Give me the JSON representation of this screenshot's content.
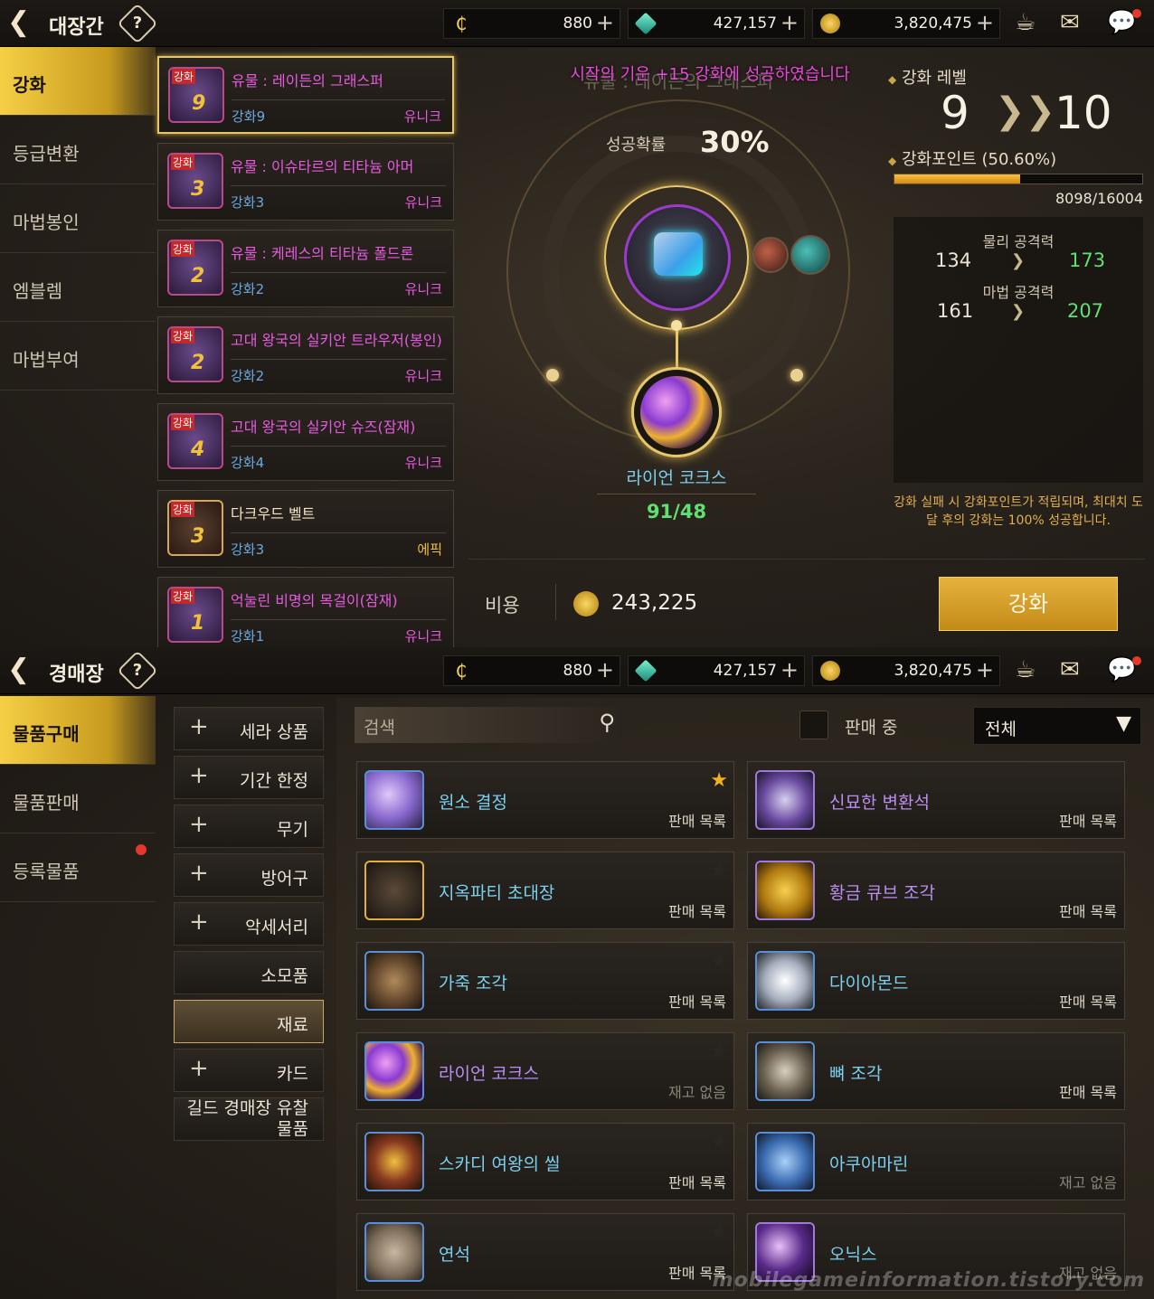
{
  "top_panel": {
    "title": "대장간",
    "help": "?",
    "currency": {
      "cera": "880",
      "gem": "427,157",
      "gold": "3,820,475",
      "plus": "+"
    },
    "sidebar": [
      "강화",
      "등급변환",
      "마법봉인",
      "엠블렘",
      "마법부여"
    ],
    "items": [
      {
        "pre": "강화",
        "lv": "9",
        "name": "유물 : 레이든의 그래스퍼",
        "stage": "강화9",
        "grade": "유니크"
      },
      {
        "pre": "강화",
        "lv": "3",
        "name": "유물 : 이슈타르의 티타늄 아머",
        "stage": "강화3",
        "grade": "유니크"
      },
      {
        "pre": "강화",
        "lv": "2",
        "name": "유물 : 케레스의 티타늄 폴드론",
        "stage": "강화2",
        "grade": "유니크"
      },
      {
        "pre": "강화",
        "lv": "2",
        "name": "고대 왕국의 실키안 트라우저(봉인)",
        "stage": "강화2",
        "grade": "유니크"
      },
      {
        "pre": "강화",
        "lv": "4",
        "name": "고대 왕국의 실키안 슈즈(잠재)",
        "stage": "강화4",
        "grade": "유니크"
      },
      {
        "pre": "강화",
        "lv": "3",
        "name": "다크우드 벨트",
        "stage": "강화3",
        "grade": "에픽"
      },
      {
        "pre": "강화",
        "lv": "1",
        "name": "억눌린 비명의 목걸이(잠재)",
        "stage": "강화1",
        "grade": "유니크"
      }
    ],
    "toast": "시작의 기운 +15 강화에 성공하였습니다",
    "ghost_title": "유물 : 레이든의 그래스퍼",
    "success_label": "성공확률",
    "success_value": "30%",
    "material_name": "라이언 코크스",
    "material_count": "91/48",
    "level_label": "강화 레벨",
    "level_from": "9",
    "level_to": "10",
    "points_label": "강화포인트 (50.60%)",
    "points_progress": 0.506,
    "points_value": "8098/16004",
    "phys_label": "물리 공격력",
    "phys_from": "134",
    "phys_to": "173",
    "magic_label": "마법 공격력",
    "magic_from": "161",
    "magic_to": "207",
    "notice": "강화 실패 시 강화포인트가 적립되며, 최대치 도달 후의 강화는 100% 성공합니다.",
    "cost_label": "비용",
    "cost_value": "243,225",
    "enhance_button": "강화"
  },
  "bottom_panel": {
    "title": "경매장",
    "help": "?",
    "currency": {
      "cera": "880",
      "gem": "427,157",
      "gold": "3,820,475",
      "plus": "+"
    },
    "sidebar": [
      "물품구매",
      "물품판매",
      "등록물품"
    ],
    "categories": [
      {
        "label": "세라 상품",
        "plus": "+"
      },
      {
        "label": "기간 한정",
        "plus": "+"
      },
      {
        "label": "무기",
        "plus": "+"
      },
      {
        "label": "방어구",
        "plus": "+"
      },
      {
        "label": "악세서리",
        "plus": "+"
      },
      {
        "label": "소모품",
        "plus": ""
      },
      {
        "label": "재료",
        "plus": ""
      },
      {
        "label": "카드",
        "plus": "+"
      },
      {
        "label": "길드 경매장 유찰 물품",
        "plus": ""
      }
    ],
    "search_placeholder": "검색",
    "selling_label": "판매 중",
    "filter_value": "전체",
    "market": [
      {
        "name": "원소 결정",
        "status": "판매 목록"
      },
      {
        "name": "신묘한 변환석",
        "status": "판매 목록"
      },
      {
        "name": "지옥파티 초대장",
        "status": "판매 목록"
      },
      {
        "name": "황금 큐브 조각",
        "status": "판매 목록"
      },
      {
        "name": "가죽 조각",
        "status": "판매 목록"
      },
      {
        "name": "다이아몬드",
        "status": "판매 목록"
      },
      {
        "name": "라이언 코크스",
        "status": "재고 없음"
      },
      {
        "name": "뼈 조각",
        "status": "판매 목록"
      },
      {
        "name": "스카디 여왕의 씰",
        "status": "판매 목록"
      },
      {
        "name": "아쿠아마린",
        "status": "재고 없음"
      },
      {
        "name": "연석",
        "status": "판매 목록"
      },
      {
        "name": "오닉스",
        "status": "재고 없음"
      }
    ],
    "watermark": "mobilegameinformation.tistory.com"
  }
}
